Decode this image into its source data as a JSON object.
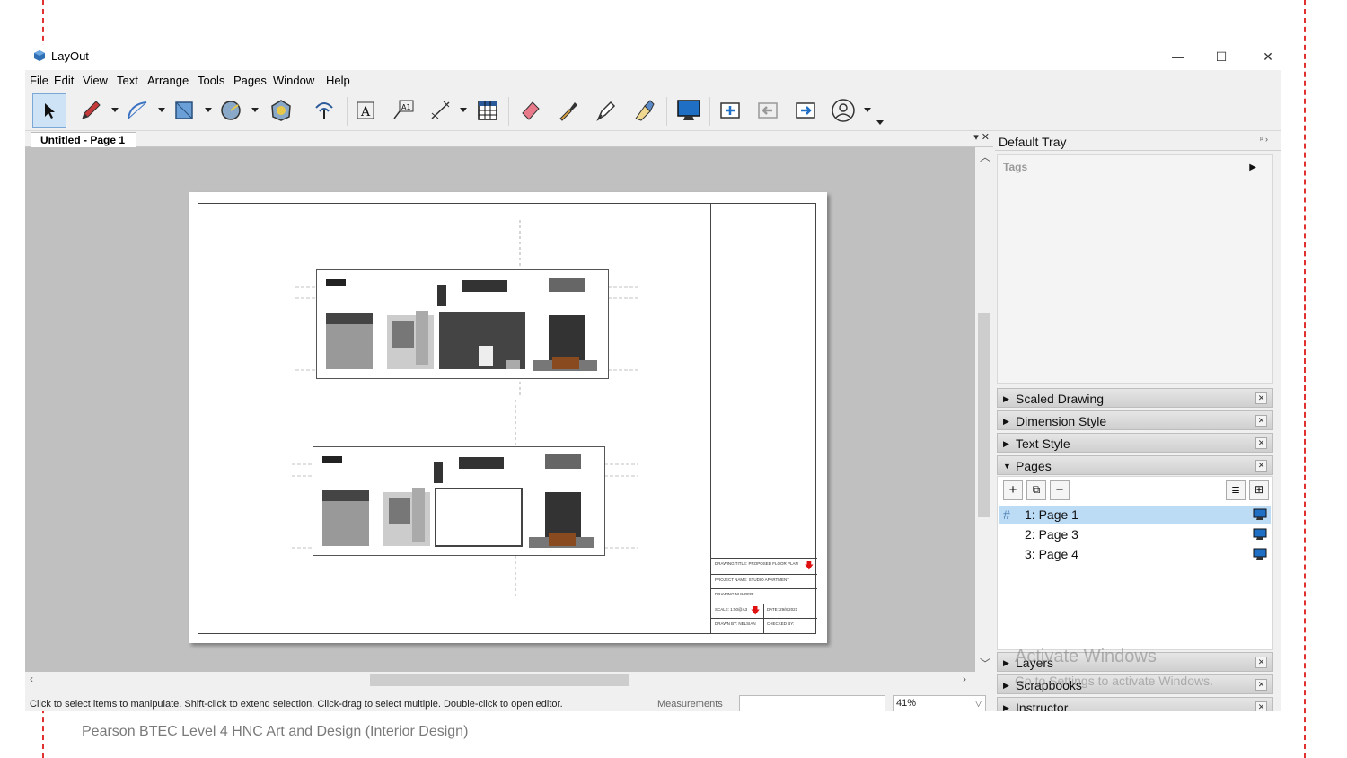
{
  "window": {
    "app_title": "LayOut",
    "controls": {
      "minimize": "—",
      "maximize": "☐",
      "close": "✕"
    }
  },
  "menu": [
    "File",
    "Edit",
    "View",
    "Text",
    "Arrange",
    "Tools",
    "Pages",
    "Window",
    "Help"
  ],
  "toolbar": {
    "icons": [
      "select-arrow",
      "pencil",
      "arc",
      "rectangle",
      "circle",
      "polygon",
      "offset",
      "text",
      "label",
      "dimension",
      "table",
      "eraser",
      "style-eyedropper",
      "split",
      "join",
      "presentation",
      "add-page",
      "previous-page",
      "next-page",
      "account"
    ]
  },
  "document": {
    "tab_label": "Untitled - Page 1",
    "tab_controls": "▾  ✕"
  },
  "titleblock": {
    "drawing_title": "DRAWING TITLE: PROPOSED FLOOR PLAN",
    "project_name": "PROJECT NAME: STUDIO APARTMENT",
    "drawing_number": "DRAWING NUMBER:",
    "scale": "SCALE: 1:50@A3",
    "date": "DATE: 29/8/2021",
    "drawn_by": "DRAWN BY: NELSIAN",
    "checked_by": "CHECKED BY:"
  },
  "status": {
    "hint": "Click to select items to manipulate. Shift-click to extend selection. Click-drag to select multiple. Double-click to open editor.",
    "measurements_label": "Measurements",
    "measurements_value": "",
    "zoom": "41%"
  },
  "tray": {
    "title": "Default Tray",
    "pin": "ᵖ ›",
    "tags_label": "Tags",
    "panels_top": [
      "Scaled Drawing",
      "Dimension Style",
      "Text Style"
    ],
    "pages_panel": "Pages",
    "pages": [
      {
        "num": "1:",
        "name": "Page 1",
        "selected": true
      },
      {
        "num": "2:",
        "name": "Page 3",
        "selected": false
      },
      {
        "num": "3:",
        "name": "Page 4",
        "selected": false
      }
    ],
    "panels_bottom": [
      "Layers",
      "Scrapbooks",
      "Instructor"
    ]
  },
  "watermark": {
    "line1": "Activate Windows",
    "line2": "Go to Settings to activate Windows."
  },
  "footer": "Pearson BTEC Level 4 HNC Art and Design (Interior Design)",
  "colors": {
    "accent_dash": "#e03030",
    "selection": "#bcdcf6",
    "presentation_blue": "#1f6fc5"
  }
}
